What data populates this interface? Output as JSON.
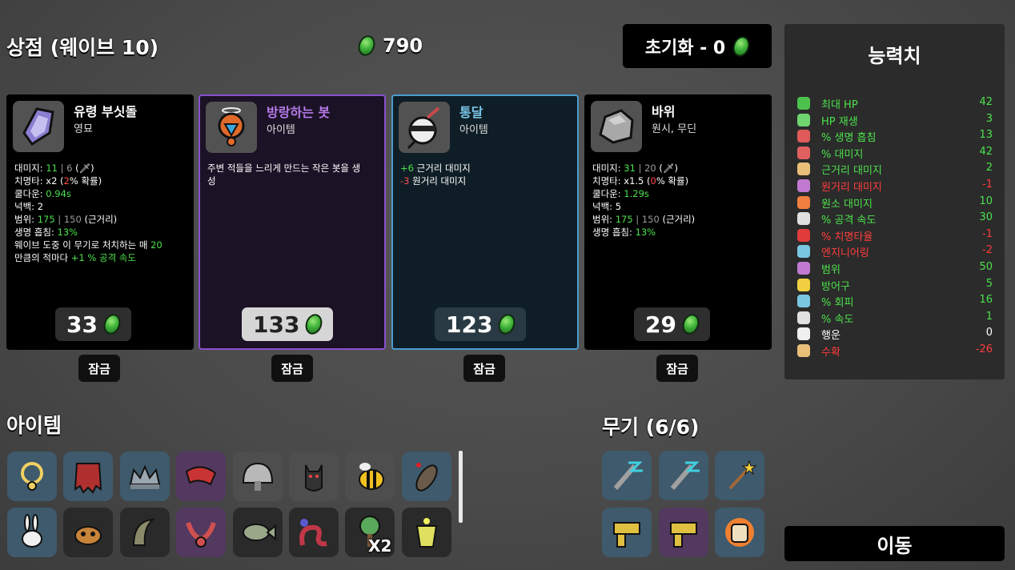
{
  "header": {
    "title": "상점 (웨이브 10)",
    "materials": "790",
    "reroll_label": "초기화 - 0"
  },
  "shop": [
    {
      "name": "유령 부싯돌",
      "type": "영묘",
      "stats": [
        [
          {
            "t": "대미지: "
          },
          {
            "t": "11",
            "c": "g"
          },
          {
            "t": " | ",
            "c": "dim"
          },
          {
            "t": "6",
            "c": "dim"
          },
          {
            "t": " (🗡)"
          }
        ],
        [
          {
            "t": "치명타: x2 ("
          },
          {
            "t": "2",
            "c": "r"
          },
          {
            "t": "% 확률)"
          }
        ],
        [
          {
            "t": "쿨다운: "
          },
          {
            "t": "0.94s",
            "c": "g"
          }
        ],
        [
          {
            "t": "넉백: 2"
          }
        ],
        [
          {
            "t": "범위: "
          },
          {
            "t": "175",
            "c": "g"
          },
          {
            "t": " | ",
            "c": "dim"
          },
          {
            "t": "150",
            "c": "dim"
          },
          {
            "t": " (근거리)"
          }
        ],
        [
          {
            "t": "생명 흡침: "
          },
          {
            "t": "13%",
            "c": "g"
          }
        ],
        [
          {
            "t": "웨이브 도중 이 무기로 처치하는 매 "
          },
          {
            "t": "20",
            "c": "g"
          }
        ],
        [
          {
            "t": "만큼의 적마다 "
          },
          {
            "t": "+1 % 공격 속도",
            "c": "g"
          }
        ]
      ],
      "price": "33",
      "lock": "잠금"
    },
    {
      "name": "방랑하는 봇",
      "type": "아이템",
      "stats": [
        [
          {
            "t": "주변 적들을 느리게 만드는 작은 봇을 생"
          }
        ],
        [
          {
            "t": "성"
          }
        ]
      ],
      "price": "133",
      "lock": "잠금"
    },
    {
      "name": "통달",
      "type": "아이템",
      "stats": [
        [
          {
            "t": "+6",
            "c": "g"
          },
          {
            "t": " 근거리 대미지"
          }
        ],
        [
          {
            "t": "-3",
            "c": "r"
          },
          {
            "t": " 원거리 대미지"
          }
        ]
      ],
      "price": "123",
      "lock": "잠금"
    },
    {
      "name": "바위",
      "type": "원시, 무딘",
      "stats": [
        [
          {
            "t": "대미지: "
          },
          {
            "t": "31",
            "c": "g"
          },
          {
            "t": " | ",
            "c": "dim"
          },
          {
            "t": "20",
            "c": "dim"
          },
          {
            "t": " (🗡)"
          }
        ],
        [
          {
            "t": "치명타: x1.5 ("
          },
          {
            "t": "0",
            "c": "r"
          },
          {
            "t": "% 확률)"
          }
        ],
        [
          {
            "t": "쿨다운: "
          },
          {
            "t": "1.29s",
            "c": "g"
          }
        ],
        [
          {
            "t": "넉백: 5"
          }
        ],
        [
          {
            "t": "범위: "
          },
          {
            "t": "175",
            "c": "g"
          },
          {
            "t": " | ",
            "c": "dim"
          },
          {
            "t": "150",
            "c": "dim"
          },
          {
            "t": " (근거리)"
          }
        ],
        [
          {
            "t": "생명 흡침: "
          },
          {
            "t": "13%",
            "c": "g"
          }
        ]
      ],
      "price": "29",
      "lock": "잠금"
    }
  ],
  "items": {
    "title": "아이템",
    "slots": [
      {
        "icon": "pendant-icon",
        "tint": "blue"
      },
      {
        "icon": "hide-icon",
        "tint": "blue"
      },
      {
        "icon": "crown-icon",
        "tint": "blue"
      },
      {
        "icon": "bandana-icon",
        "tint": "purple"
      },
      {
        "icon": "helmet-icon",
        "tint": "gray"
      },
      {
        "icon": "bat-icon",
        "tint": "gray"
      },
      {
        "icon": "bee-icon",
        "tint": "gray"
      },
      {
        "icon": "cocoon-icon",
        "tint": "blue"
      },
      {
        "icon": "rabbit-icon",
        "tint": "blue"
      },
      {
        "icon": "dog-icon",
        "tint": "dark"
      },
      {
        "icon": "scythe-icon",
        "tint": "dark"
      },
      {
        "icon": "claws-icon",
        "tint": "purple"
      },
      {
        "icon": "fish-icon",
        "tint": "dark"
      },
      {
        "icon": "worm-icon",
        "tint": "dark"
      },
      {
        "icon": "tree-icon",
        "tint": "dark",
        "badge": "X2"
      },
      {
        "icon": "bucket-icon",
        "tint": "dark"
      }
    ]
  },
  "weapons": {
    "title": "무기 (6/6)",
    "slots": [
      {
        "icon": "lightning-shiv-icon",
        "tint": "blue"
      },
      {
        "icon": "lightning-shiv-icon",
        "tint": "blue"
      },
      {
        "icon": "wand-icon",
        "tint": "blue"
      },
      {
        "icon": "slingshot-icon",
        "tint": "blue"
      },
      {
        "icon": "slingshot-icon",
        "tint": "purple"
      },
      {
        "icon": "fist-icon",
        "tint": "blue"
      }
    ]
  },
  "stats_panel": {
    "title": "능력치",
    "rows": [
      {
        "icon": "heart-icon",
        "name": "최대 HP",
        "value": "42",
        "color": "#4ce14c",
        "iconColor": "#4cc24c"
      },
      {
        "icon": "regen-icon",
        "name": "HP 재생",
        "value": "3",
        "color": "#4ce14c",
        "iconColor": "#6fd36f"
      },
      {
        "icon": "lifesteal-icon",
        "name": "% 생명 흡침",
        "value": "13",
        "color": "#4ce14c",
        "iconColor": "#e05a5a"
      },
      {
        "icon": "damage-icon",
        "name": "% 대미지",
        "value": "42",
        "color": "#4ce14c",
        "iconColor": "#e06060"
      },
      {
        "icon": "melee-icon",
        "name": "근거리 대미지",
        "value": "2",
        "color": "#4ce14c",
        "iconColor": "#e8c07a"
      },
      {
        "icon": "ranged-icon",
        "name": "원거리 대미지",
        "value": "-1",
        "color": "#ff3c3c",
        "iconColor": "#c07ad0"
      },
      {
        "icon": "elemental-icon",
        "name": "원소 대미지",
        "value": "10",
        "color": "#4ce14c",
        "iconColor": "#f08040"
      },
      {
        "icon": "attack-speed-icon",
        "name": "% 공격 속도",
        "value": "30",
        "color": "#4ce14c",
        "iconColor": "#e0e0e0"
      },
      {
        "icon": "crit-icon",
        "name": "% 치명타율",
        "value": "-1",
        "color": "#ff3c3c",
        "iconColor": "#e03c3c"
      },
      {
        "icon": "engineering-icon",
        "name": "엔지니어링",
        "value": "-2",
        "color": "#ff3c3c",
        "iconColor": "#7ac6e0"
      },
      {
        "icon": "range-icon",
        "name": "범위",
        "value": "50",
        "color": "#4ce14c",
        "iconColor": "#c07ad0"
      },
      {
        "icon": "armor-icon",
        "name": "방어구",
        "value": "5",
        "color": "#4ce14c",
        "iconColor": "#f0d040"
      },
      {
        "icon": "dodge-icon",
        "name": "% 회피",
        "value": "16",
        "color": "#4ce14c",
        "iconColor": "#7ac6e0"
      },
      {
        "icon": "speed-icon",
        "name": "% 속도",
        "value": "1",
        "color": "#4ce14c",
        "iconColor": "#e0e0e0"
      },
      {
        "icon": "luck-icon",
        "name": "행운",
        "value": "0",
        "color": "#ffffff",
        "iconColor": "#f0f0f0"
      },
      {
        "icon": "harvesting-icon",
        "name": "수확",
        "value": "-26",
        "color": "#ff3c3c",
        "iconColor": "#e8c07a"
      }
    ]
  },
  "go_button": "이동",
  "colors": {
    "green": "#4ce14c",
    "red": "#ff3c3c",
    "purple": "#8a4fd0",
    "blue": "#4a9cd0"
  }
}
